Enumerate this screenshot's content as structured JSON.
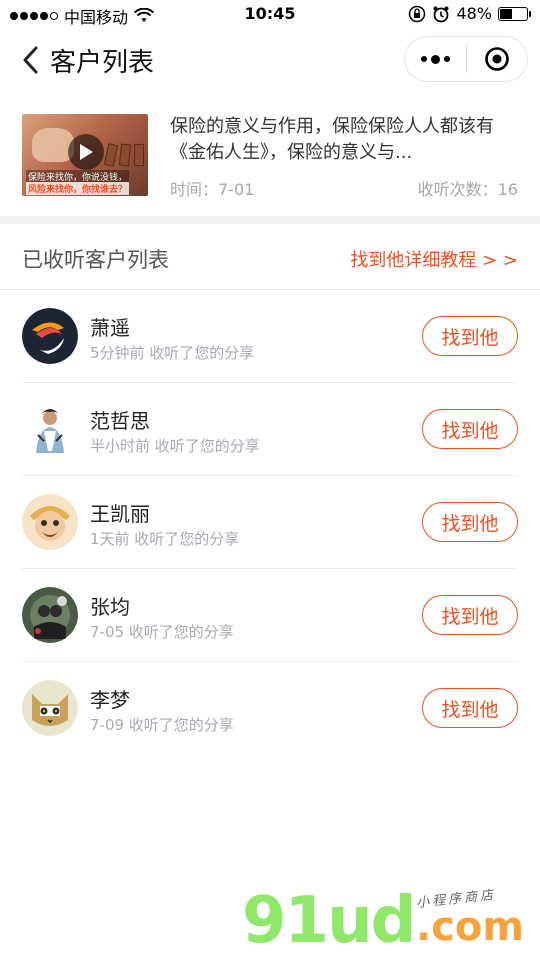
{
  "status_bar": {
    "carrier": "中国移动",
    "time": "10:45",
    "battery_text": "48%",
    "battery_level": 0.48
  },
  "nav": {
    "title": "客户列表"
  },
  "article": {
    "title": "保险的意义与作用，保险保险人人都该有《金佑人生》，保险的意义与...",
    "time_text": "时间：7-01",
    "listen_count_text": "收听次数：16",
    "thumb_caption_1": "保险来找你，你说没钱，",
    "thumb_caption_2": "风险来找你，你找谁去？"
  },
  "section": {
    "title": "已收听客户列表",
    "link": "找到他详细教程 > >"
  },
  "customers": [
    {
      "name": "萧遥",
      "activity": "5分钟前 收听了您的分享",
      "button": "找到他"
    },
    {
      "name": "范哲思",
      "activity": "半小时前 收听了您的分享",
      "button": "找到他"
    },
    {
      "name": "王凯丽",
      "activity": "1天前 收听了您的分享",
      "button": "找到他"
    },
    {
      "name": "张均",
      "activity": "7-05 收听了您的分享",
      "button": "找到他"
    },
    {
      "name": "李梦",
      "activity": "7-09 收听了您的分享",
      "button": "找到他"
    }
  ],
  "watermark": {
    "main": "91ud",
    "suffix": ".com",
    "tagline": "小程序商店"
  },
  "colors": {
    "accent": "#ef4f1f",
    "muted": "#a9a9b3"
  },
  "icons": {
    "back": "chevron-left-icon",
    "menu": "more-dots-icon",
    "close": "target-close-icon",
    "wifi": "wifi-icon",
    "lock": "orientation-lock-icon",
    "alarm": "alarm-icon",
    "play": "play-icon"
  }
}
